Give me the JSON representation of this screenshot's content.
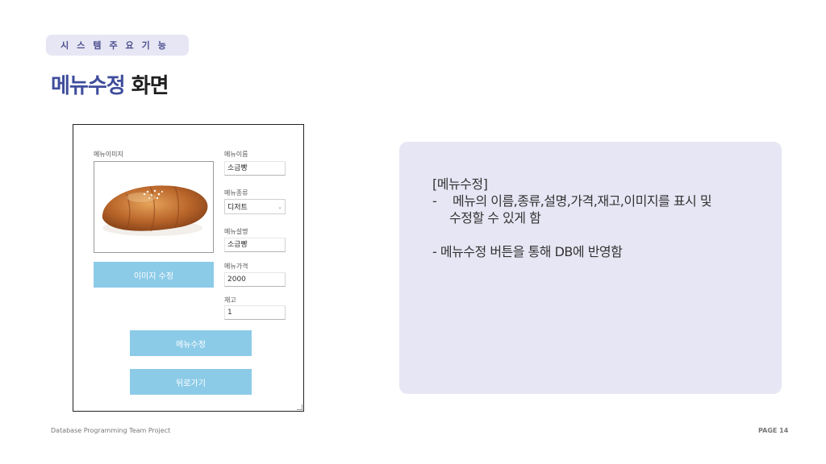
{
  "slide": {
    "section_label": "시스템주요기능",
    "title_accent": "메뉴수정",
    "title_rest": "화면",
    "footer_left": "Database Programming Team Project",
    "footer_right": "PAGE 14",
    "accent_color": "#3f4d9c",
    "panel_color": "#e7e6f4"
  },
  "app": {
    "image_label": "메뉴이미지",
    "image_description": "소금빵",
    "edit_image_button": "이미지 수정",
    "fields": {
      "name_label": "메뉴이름",
      "name_value": "소금빵",
      "category_label": "메뉴종류",
      "category_value": "디저트",
      "description_label": "메뉴설명",
      "description_value": "소금빵",
      "price_label": "메뉴가격",
      "price_value": "2000",
      "stock_label": "재고",
      "stock_value": "1"
    },
    "edit_menu_button": "메뉴수정",
    "back_button": "뒤로가기",
    "button_color": "#8ccbe8"
  },
  "description": {
    "heading": "[메뉴수정]",
    "bullet1_dash": "-",
    "bullet1_line1": "메뉴의 이름,종류,설명,가격,재고,이미지를 표시 및",
    "bullet1_line2": "수정할 수 있게 함",
    "bullet2": "- 메뉴수정 버튼을 통해 DB에 반영함"
  }
}
